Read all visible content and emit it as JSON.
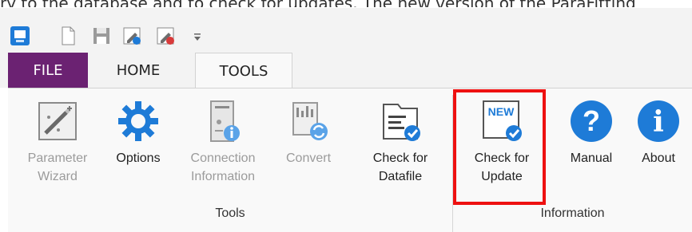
{
  "caption_fragment": "ry to the database and to check for updates. The new version of the ParaFitting",
  "quick_access": {
    "items": [
      {
        "name": "app-icon"
      },
      {
        "name": "new-document-icon"
      },
      {
        "name": "save-icon"
      },
      {
        "name": "edit-file-icon"
      },
      {
        "name": "edit-file-delete-icon"
      }
    ],
    "customize_icon": "customize-dropdown-icon"
  },
  "tabs": [
    {
      "label": "FILE",
      "active": false
    },
    {
      "label": "HOME",
      "active": false
    },
    {
      "label": "TOOLS",
      "active": true
    }
  ],
  "ribbon": {
    "groups": [
      {
        "label": "Tools",
        "commands": [
          {
            "label_line1": "Parameter",
            "label_line2": "Wizard",
            "enabled": false,
            "icon": "parameter-wizard-icon"
          },
          {
            "label_line1": "Options",
            "label_line2": "",
            "enabled": true,
            "icon": "options-gear-icon"
          },
          {
            "label_line1": "Connection",
            "label_line2": "Information",
            "enabled": false,
            "icon": "connection-information-icon"
          },
          {
            "label_line1": "Convert",
            "label_line2": "",
            "enabled": false,
            "icon": "convert-icon"
          },
          {
            "label_line1": "Check for",
            "label_line2": "Datafile",
            "enabled": true,
            "icon": "check-datafile-icon"
          }
        ]
      },
      {
        "label": "Information",
        "commands": [
          {
            "label_line1": "Check for",
            "label_line2": "Update",
            "enabled": true,
            "icon": "check-update-icon",
            "badge": "NEW",
            "highlighted": true
          },
          {
            "label_line1": "Manual",
            "label_line2": "",
            "enabled": true,
            "icon": "manual-help-icon",
            "glyph": "?"
          },
          {
            "label_line1": "About",
            "label_line2": "",
            "enabled": true,
            "icon": "about-info-icon",
            "glyph": "i"
          }
        ]
      }
    ]
  },
  "colors": {
    "file_tab": "#6b2272",
    "accent_blue": "#1e7bd7",
    "highlight_red": "#ee1111"
  }
}
